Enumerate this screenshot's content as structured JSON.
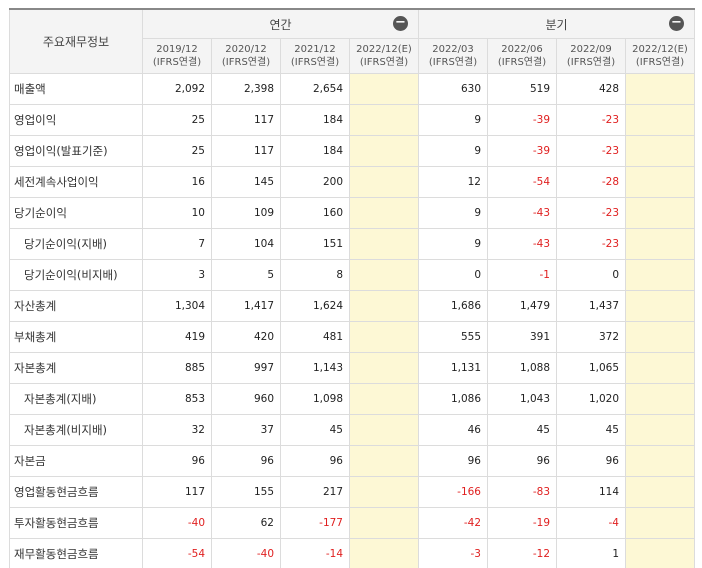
{
  "table": {
    "header_label": "주요재무정보",
    "groups": [
      {
        "label": "연간",
        "toggle_icon": "minus-circle-icon"
      },
      {
        "label": "분기",
        "toggle_icon": "minus-circle-icon"
      }
    ],
    "columns": [
      {
        "period": "2019/12",
        "basis": "(IFRS연결)"
      },
      {
        "period": "2020/12",
        "basis": "(IFRS연결)"
      },
      {
        "period": "2021/12",
        "basis": "(IFRS연결)"
      },
      {
        "period": "2022/12(E)",
        "basis": "(IFRS연결)"
      },
      {
        "period": "2022/03",
        "basis": "(IFRS연결)"
      },
      {
        "period": "2022/06",
        "basis": "(IFRS연결)"
      },
      {
        "period": "2022/09",
        "basis": "(IFRS연결)"
      },
      {
        "period": "2022/12(E)",
        "basis": "(IFRS연결)"
      }
    ],
    "rows": [
      {
        "label": "매출액",
        "indent": false,
        "values": [
          "2,092",
          "2,398",
          "2,654",
          "",
          "630",
          "519",
          "428",
          ""
        ]
      },
      {
        "label": "영업이익",
        "indent": false,
        "values": [
          "25",
          "117",
          "184",
          "",
          "9",
          "-39",
          "-23",
          ""
        ]
      },
      {
        "label": "영업이익(발표기준)",
        "indent": false,
        "values": [
          "25",
          "117",
          "184",
          "",
          "9",
          "-39",
          "-23",
          ""
        ]
      },
      {
        "label": "세전계속사업이익",
        "indent": false,
        "values": [
          "16",
          "145",
          "200",
          "",
          "12",
          "-54",
          "-28",
          ""
        ]
      },
      {
        "label": "당기순이익",
        "indent": false,
        "values": [
          "10",
          "109",
          "160",
          "",
          "9",
          "-43",
          "-23",
          ""
        ]
      },
      {
        "label": "당기순이익(지배)",
        "indent": true,
        "values": [
          "7",
          "104",
          "151",
          "",
          "9",
          "-43",
          "-23",
          ""
        ]
      },
      {
        "label": "당기순이익(비지배)",
        "indent": true,
        "values": [
          "3",
          "5",
          "8",
          "",
          "0",
          "-1",
          "0",
          ""
        ]
      },
      {
        "label": "자산총계",
        "indent": false,
        "values": [
          "1,304",
          "1,417",
          "1,624",
          "",
          "1,686",
          "1,479",
          "1,437",
          ""
        ]
      },
      {
        "label": "부채총계",
        "indent": false,
        "values": [
          "419",
          "420",
          "481",
          "",
          "555",
          "391",
          "372",
          ""
        ]
      },
      {
        "label": "자본총계",
        "indent": false,
        "values": [
          "885",
          "997",
          "1,143",
          "",
          "1,131",
          "1,088",
          "1,065",
          ""
        ]
      },
      {
        "label": "자본총계(지배)",
        "indent": true,
        "values": [
          "853",
          "960",
          "1,098",
          "",
          "1,086",
          "1,043",
          "1,020",
          ""
        ]
      },
      {
        "label": "자본총계(비지배)",
        "indent": true,
        "values": [
          "32",
          "37",
          "45",
          "",
          "46",
          "45",
          "45",
          ""
        ]
      },
      {
        "label": "자본금",
        "indent": false,
        "values": [
          "96",
          "96",
          "96",
          "",
          "96",
          "96",
          "96",
          ""
        ]
      },
      {
        "label": "영업활동현금흐름",
        "indent": false,
        "values": [
          "117",
          "155",
          "217",
          "",
          "-166",
          "-83",
          "114",
          ""
        ]
      },
      {
        "label": "투자활동현금흐름",
        "indent": false,
        "values": [
          "-40",
          "62",
          "-177",
          "",
          "-42",
          "-19",
          "-4",
          ""
        ]
      },
      {
        "label": "재무활동현금흐름",
        "indent": false,
        "values": [
          "-54",
          "-40",
          "-14",
          "",
          "-3",
          "-12",
          "1",
          ""
        ]
      }
    ],
    "colors": {
      "negative": "#e02020",
      "estimate_bg": "#fdf8d5",
      "header_bg": "#f4f4f4"
    }
  }
}
